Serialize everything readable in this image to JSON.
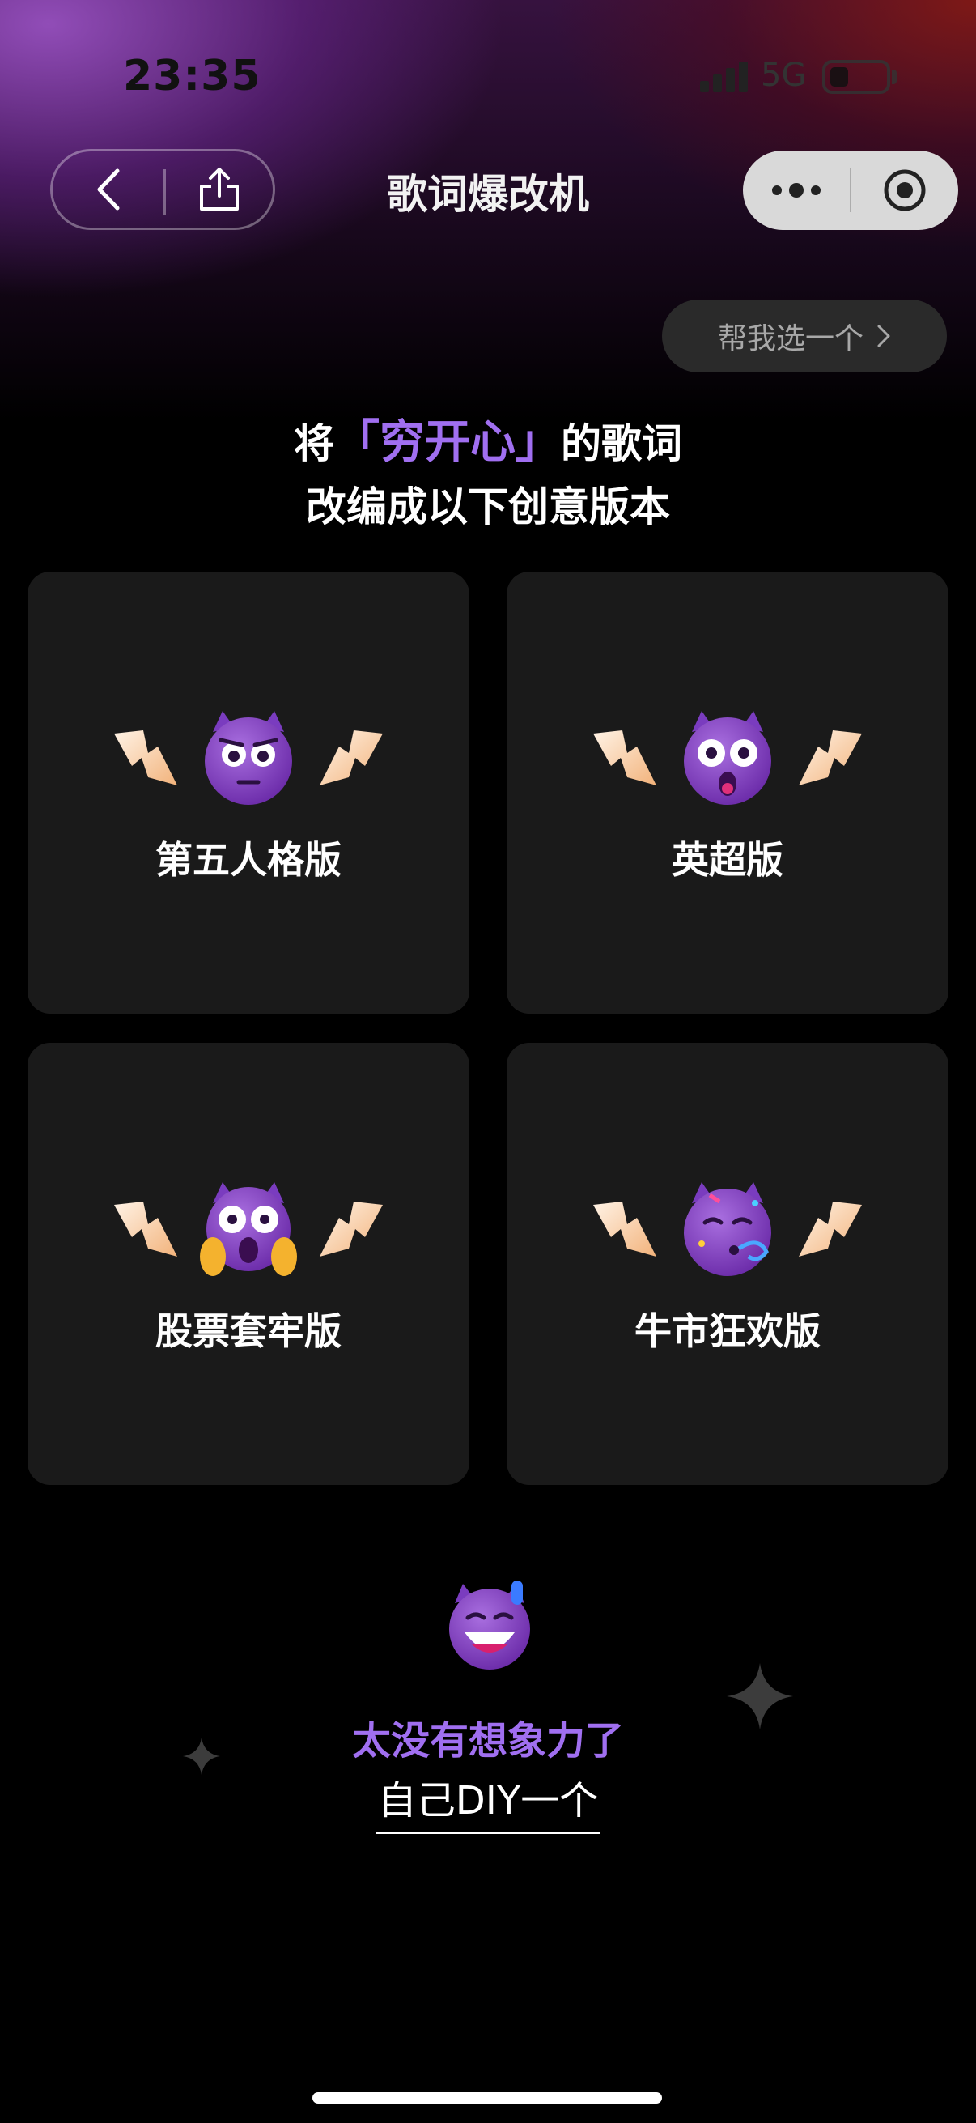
{
  "status_bar": {
    "time": "23:35",
    "network": "5G"
  },
  "nav": {
    "title": "歌词爆改机"
  },
  "pick_button": {
    "label": "帮我选一个"
  },
  "headline": {
    "prefix": "将",
    "song": "「穷开心」",
    "suffix": "的歌词",
    "line2": "改编成以下创意版本"
  },
  "cards": [
    {
      "label": "第五人格版",
      "emoji": "devil-frown"
    },
    {
      "label": "英超版",
      "emoji": "devil-shock"
    },
    {
      "label": "股票套牢版",
      "emoji": "devil-scream"
    },
    {
      "label": "牛市狂欢版",
      "emoji": "devil-party"
    }
  ],
  "bottom": {
    "no_idea": "太没有想象力了",
    "diy": "自己DIY一个"
  },
  "colors": {
    "accent": "#a06ff0",
    "card_bg": "#1a1a1a",
    "page_bg": "#000000"
  }
}
